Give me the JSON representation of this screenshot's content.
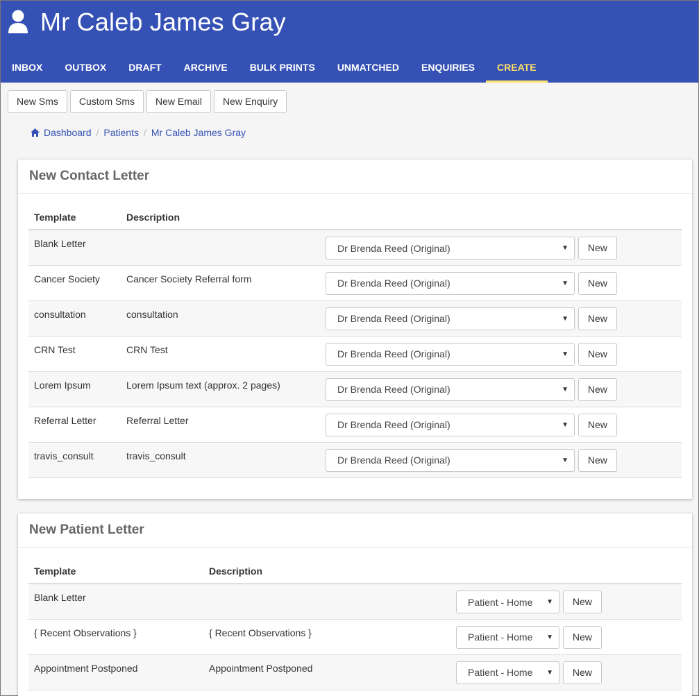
{
  "header": {
    "title": "Mr Caleb James Gray",
    "nav": [
      {
        "label": "INBOX"
      },
      {
        "label": "OUTBOX"
      },
      {
        "label": "DRAFT"
      },
      {
        "label": "ARCHIVE"
      },
      {
        "label": "BULK PRINTS"
      },
      {
        "label": "UNMATCHED"
      },
      {
        "label": "ENQUIRIES"
      },
      {
        "label": "CREATE",
        "active": true
      }
    ]
  },
  "toolbar": {
    "new_sms": "New Sms",
    "custom_sms": "Custom Sms",
    "new_email": "New Email",
    "new_enquiry": "New Enquiry"
  },
  "breadcrumb": {
    "dashboard": "Dashboard",
    "patients": "Patients",
    "patient": "Mr Caleb James Gray",
    "separator": "/"
  },
  "contact_letter": {
    "title": "New Contact Letter",
    "col_template": "Template",
    "col_description": "Description",
    "new_label": "New",
    "rows": [
      {
        "template": "Blank Letter",
        "description": "",
        "selected": "Dr Brenda Reed (Original)"
      },
      {
        "template": "Cancer Society",
        "description": "Cancer Society Referral form",
        "selected": "Dr Brenda Reed (Original)"
      },
      {
        "template": "consultation",
        "description": "consultation",
        "selected": "Dr Brenda Reed (Original)"
      },
      {
        "template": "CRN Test",
        "description": "CRN Test",
        "selected": "Dr Brenda Reed (Original)"
      },
      {
        "template": "Lorem Ipsum",
        "description": "Lorem Ipsum text (approx. 2 pages)",
        "selected": "Dr Brenda Reed (Original)"
      },
      {
        "template": "Referral Letter",
        "description": "Referral Letter",
        "selected": "Dr Brenda Reed (Original)"
      },
      {
        "template": "travis_consult",
        "description": "travis_consult",
        "selected": "Dr Brenda Reed (Original)"
      }
    ]
  },
  "patient_letter": {
    "title": "New Patient Letter",
    "col_template": "Template",
    "col_description": "Description",
    "new_label": "New",
    "rows": [
      {
        "template": "Blank Letter",
        "description": "",
        "selected": "Patient - Home"
      },
      {
        "template": "{ Recent Observations }",
        "description": "{ Recent Observations }",
        "selected": "Patient - Home"
      },
      {
        "template": "Appointment Postponed",
        "description": "Appointment Postponed",
        "selected": "Patient - Home"
      }
    ]
  },
  "colors": {
    "header_bg": "#3551b5",
    "active_nav": "#ffe066",
    "link": "#3551b5"
  },
  "icons": {
    "user": "user-icon",
    "home": "home-icon",
    "caret": "caret-down-icon"
  }
}
